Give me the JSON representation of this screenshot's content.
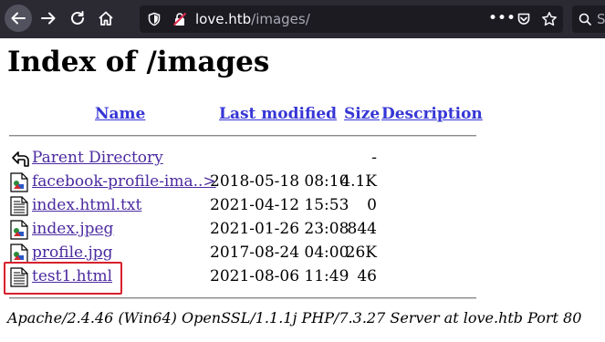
{
  "browser": {
    "url_host": "love.htb",
    "url_path": "/images/",
    "more_label": "•••",
    "search_initial": "S"
  },
  "page": {
    "title": "Index of /images",
    "columns": {
      "name": "Name",
      "modified": "Last modified",
      "size": "Size",
      "description": "Description"
    },
    "rows": [
      {
        "icon": "back-icon",
        "name": "Parent Directory",
        "modified": "",
        "size": "-"
      },
      {
        "icon": "image-file-icon",
        "name": "facebook-profile-ima..>",
        "modified": "2018-05-18 08:10",
        "size": "4.1K"
      },
      {
        "icon": "text-file-icon",
        "name": "index.html.txt",
        "modified": "2021-04-12 15:53",
        "size": "0"
      },
      {
        "icon": "image-file-icon",
        "name": "index.jpeg",
        "modified": "2021-01-26 23:08",
        "size": "844"
      },
      {
        "icon": "image-file-icon",
        "name": "profile.jpg",
        "modified": "2017-08-24 04:00",
        "size": "26K"
      },
      {
        "icon": "text-file-icon",
        "name": "test1.html",
        "modified": "2021-08-06 11:49",
        "size": "46"
      }
    ],
    "footer": "Apache/2.4.46 (Win64) OpenSSL/1.1.1j PHP/7.3.27 Server at love.htb Port 80"
  },
  "colors": {
    "toolbar": "#2b2a33",
    "urlbar": "#1c1b22",
    "link": "#3636d6",
    "visited_link": "#4b2aa0",
    "highlight": "#d8202c"
  }
}
